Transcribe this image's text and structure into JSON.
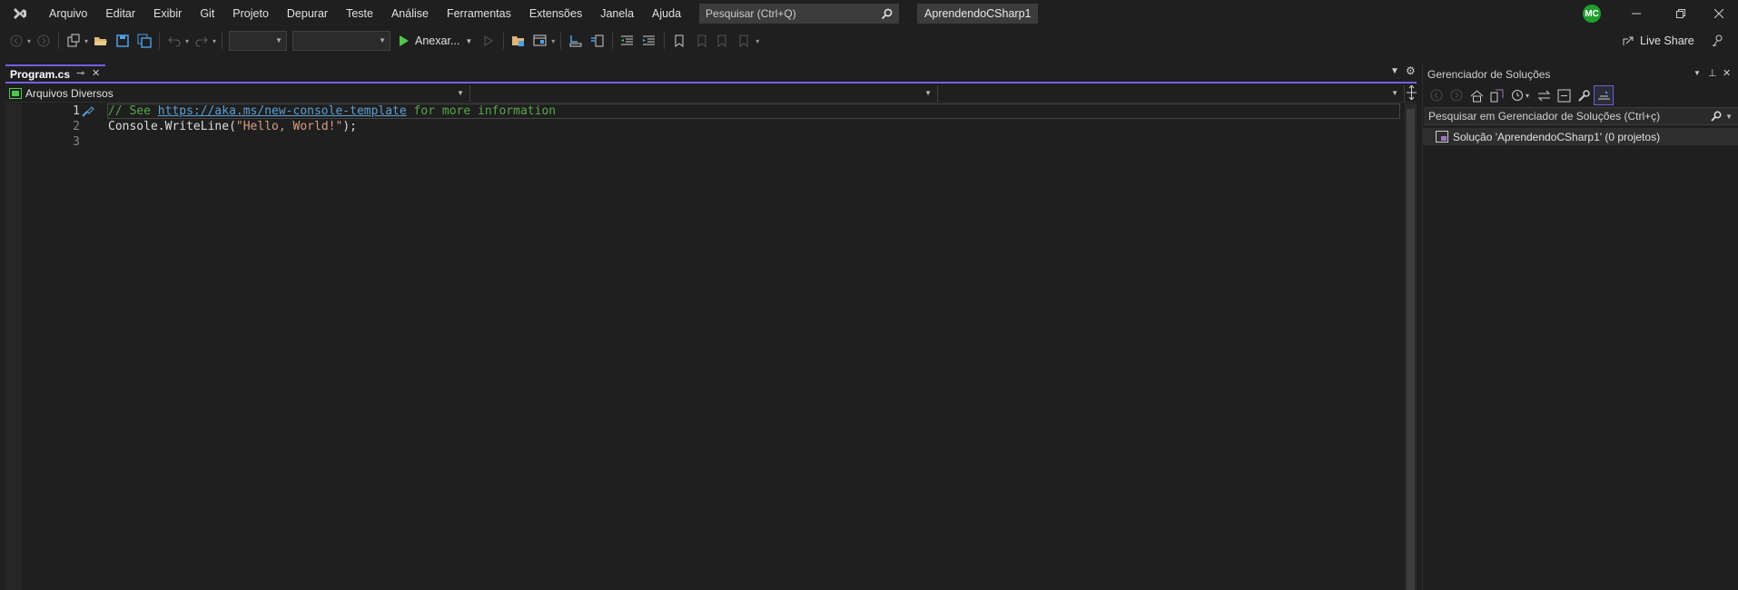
{
  "menu": {
    "items": [
      "Arquivo",
      "Editar",
      "Exibir",
      "Git",
      "Projeto",
      "Depurar",
      "Teste",
      "Análise",
      "Ferramentas",
      "Extensões",
      "Janela",
      "Ajuda"
    ]
  },
  "search": {
    "placeholder": "Pesquisar (Ctrl+Q)"
  },
  "solution_badge": "AprendendoCSharp1",
  "user": {
    "initials": "MC",
    "color": "#1f9e2e"
  },
  "toolbar": {
    "run_label": "Anexar...",
    "liveshare_label": "Live Share"
  },
  "editor": {
    "tab_label": "Program.cs",
    "nav_scope": "Arquivos Diversos",
    "accent_color": "#7160e8",
    "lines": [
      {
        "number": "1",
        "comment_prefix": "// See ",
        "link": "https://aka.ms/new-console-template",
        "comment_suffix": " for more information"
      },
      {
        "number": "2",
        "obj": "Console",
        "dot": ".",
        "method": "WriteLine",
        "open": "(",
        "string": "\"Hello, World!\"",
        "close": ");"
      },
      {
        "number": "3"
      }
    ]
  },
  "solution_explorer": {
    "title": "Gerenciador de Soluções",
    "search_placeholder": "Pesquisar em Gerenciador de Soluções (Ctrl+ç)",
    "root_item": "Solução 'AprendendoCSharp1' (0 projetos)"
  }
}
